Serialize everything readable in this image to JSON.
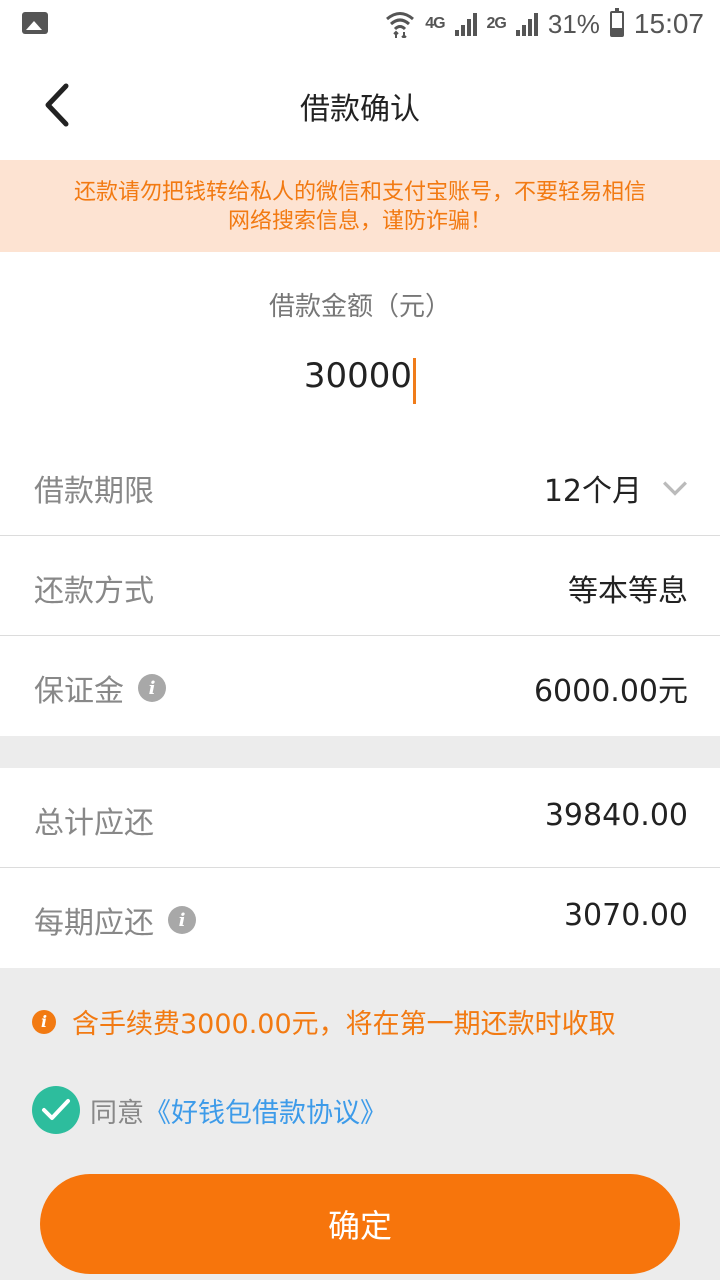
{
  "status_bar": {
    "network_4g": "4G",
    "network_2g": "2G",
    "battery_percent": "31%",
    "time": "15:07"
  },
  "nav": {
    "title": "借款确认"
  },
  "notice": {
    "line1": "还款请勿把钱转给私人的微信和支付宝账号，不要轻易相信",
    "line2": "网络搜索信息，谨防诈骗！"
  },
  "amount": {
    "label": "借款金额（元）",
    "value": "30000"
  },
  "rows": {
    "term": {
      "label": "借款期限",
      "value": "12个月"
    },
    "method": {
      "label": "还款方式",
      "value": "等本等息"
    },
    "deposit": {
      "label": "保证金",
      "value": "6000.00元"
    },
    "total": {
      "label": "总计应还",
      "value": "39840.00"
    },
    "per_period": {
      "label": "每期应还",
      "value": "3070.00"
    }
  },
  "fee_note": "含手续费3000.00元，将在第一期还款时收取",
  "agreement": {
    "prefix": "同意",
    "link": "《好钱包借款协议》",
    "checked": true
  },
  "confirm_label": "确定",
  "colors": {
    "accent": "#f7750c",
    "notice_bg": "#fde3d2",
    "check": "#2dbd9d",
    "link": "#3d9be9"
  },
  "icons": [
    "image-icon",
    "wifi-icon",
    "signal-icon",
    "battery-icon",
    "back-arrow-icon",
    "chevron-down-icon",
    "info-icon",
    "check-icon"
  ]
}
